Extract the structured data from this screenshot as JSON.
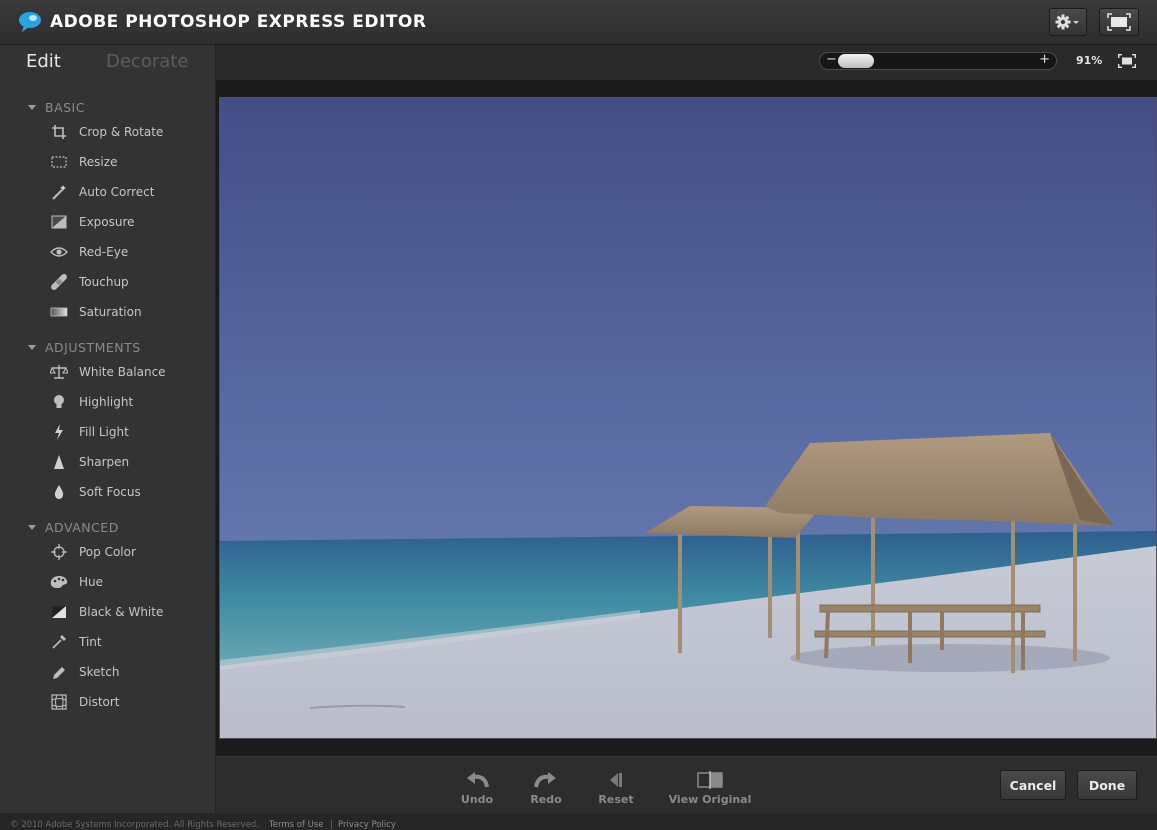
{
  "app": {
    "title": "ADOBE PHOTOSHOP EXPRESS EDITOR"
  },
  "titlebar": {
    "settings_icon": "gear-icon",
    "fullscreen_icon": "fullscreen-icon"
  },
  "modes": {
    "edit": "Edit",
    "decorate": "Decorate"
  },
  "sections": {
    "basic": {
      "label": "BASIC",
      "tools": [
        {
          "label": "Crop & Rotate",
          "icon": "crop-icon"
        },
        {
          "label": "Resize",
          "icon": "resize-icon"
        },
        {
          "label": "Auto Correct",
          "icon": "magic-wand-icon"
        },
        {
          "label": "Exposure",
          "icon": "exposure-icon"
        },
        {
          "label": "Red-Eye",
          "icon": "eye-icon"
        },
        {
          "label": "Touchup",
          "icon": "bandage-icon"
        },
        {
          "label": "Saturation",
          "icon": "saturation-icon"
        }
      ]
    },
    "adjustments": {
      "label": "ADJUSTMENTS",
      "tools": [
        {
          "label": "White Balance",
          "icon": "scale-icon"
        },
        {
          "label": "Highlight",
          "icon": "lightbulb-icon"
        },
        {
          "label": "Fill Light",
          "icon": "lightning-icon"
        },
        {
          "label": "Sharpen",
          "icon": "triangle-icon"
        },
        {
          "label": "Soft Focus",
          "icon": "drop-icon"
        }
      ]
    },
    "advanced": {
      "label": "ADVANCED",
      "tools": [
        {
          "label": "Pop Color",
          "icon": "crosshair-icon"
        },
        {
          "label": "Hue",
          "icon": "palette-icon"
        },
        {
          "label": "Black & White",
          "icon": "black-white-icon"
        },
        {
          "label": "Tint",
          "icon": "dropper-icon"
        },
        {
          "label": "Sketch",
          "icon": "pencil-icon"
        },
        {
          "label": "Distort",
          "icon": "distort-icon"
        }
      ]
    }
  },
  "zoom": {
    "minus": "−",
    "plus": "+",
    "percent": "91%",
    "level": 0.91
  },
  "actions": {
    "undo": "Undo",
    "redo": "Redo",
    "reset": "Reset",
    "view_original": "View Original",
    "cancel": "Cancel",
    "done": "Done"
  },
  "footer": {
    "copyright": "© 2010 Adobe Systems Incorporated. All Rights Reserved.",
    "terms": "Terms of Use",
    "separator": "|",
    "privacy": "Privacy Policy"
  },
  "colors": {
    "accent": "#2aa4e0",
    "background": "#2b2b2b",
    "sidebar": "#333333"
  }
}
